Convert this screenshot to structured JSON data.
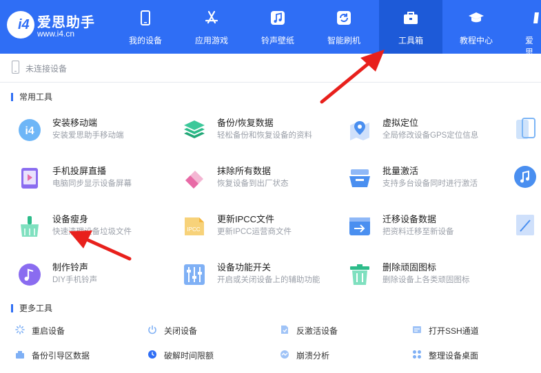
{
  "brand": {
    "name": "爱思助手",
    "url": "www.i4.cn",
    "logo_text": "i4"
  },
  "nav": [
    {
      "label": "我的设备",
      "icon": "phone-icon"
    },
    {
      "label": "应用游戏",
      "icon": "app-store-icon"
    },
    {
      "label": "铃声壁纸",
      "icon": "music-icon"
    },
    {
      "label": "智能刷机",
      "icon": "refresh-icon"
    },
    {
      "label": "工具箱",
      "icon": "toolbox-icon",
      "active": true
    },
    {
      "label": "教程中心",
      "icon": "graduation-cap-icon"
    },
    {
      "label": "爱思",
      "icon": "store-icon"
    }
  ],
  "status": {
    "text": "未连接设备"
  },
  "sections": {
    "common": "常用工具",
    "more": "更多工具"
  },
  "tools": [
    {
      "name": "安装移动端",
      "desc": "安装爱思助手移动端",
      "icon": "i4-mobile-icon",
      "color": "#5aa9f5"
    },
    {
      "name": "备份/恢复数据",
      "desc": "轻松备份和恢复设备的资料",
      "icon": "layers-icon",
      "color": "#2dbc8a"
    },
    {
      "name": "虚拟定位",
      "desc": "全局修改设备GPS定位信息",
      "icon": "location-icon",
      "color": "#4a8ff0"
    },
    {
      "name": "手机投屏直播",
      "desc": "电脑同步显示设备屏幕",
      "icon": "screen-cast-icon",
      "color": "#8a6cf0"
    },
    {
      "name": "抹除所有数据",
      "desc": "恢复设备到出厂状态",
      "icon": "eraser-icon",
      "color": "#e86aa6"
    },
    {
      "name": "批量激活",
      "desc": "支持多台设备同时进行激活",
      "icon": "batch-activate-icon",
      "color": "#4a8ff0"
    },
    {
      "name": "设备瘦身",
      "desc": "快速清理设备垃圾文件",
      "icon": "broom-icon",
      "color": "#2dbc8a"
    },
    {
      "name": "更新IPCC文件",
      "desc": "更新IPCC运营商文件",
      "icon": "ipcc-file-icon",
      "color": "#f3b640"
    },
    {
      "name": "迁移设备数据",
      "desc": "把资料迁移至新设备",
      "icon": "migrate-icon",
      "color": "#4a8ff0"
    },
    {
      "name": "制作铃声",
      "desc": "DIY手机铃声",
      "icon": "ringtone-icon",
      "color": "#8a6cf0"
    },
    {
      "name": "设备功能开关",
      "desc": "开启或关闭设备上的辅助功能",
      "icon": "switches-icon",
      "color": "#4a8ff0"
    },
    {
      "name": "删除顽固图标",
      "desc": "删除设备上各类顽固图标",
      "icon": "trash-icon",
      "color": "#2dbc8a"
    }
  ],
  "more_tools": [
    {
      "label": "重启设备",
      "icon": "restart-icon"
    },
    {
      "label": "关闭设备",
      "icon": "power-icon"
    },
    {
      "label": "反激活设备",
      "icon": "deactivate-icon"
    },
    {
      "label": "打开SSH通道",
      "icon": "ssh-icon"
    },
    {
      "label": "备份引导区数据",
      "icon": "backup-boot-icon"
    },
    {
      "label": "破解时间限额",
      "icon": "clock-icon"
    },
    {
      "label": "崩溃分析",
      "icon": "crash-analysis-icon"
    },
    {
      "label": "整理设备桌面",
      "icon": "grid-icon"
    }
  ]
}
